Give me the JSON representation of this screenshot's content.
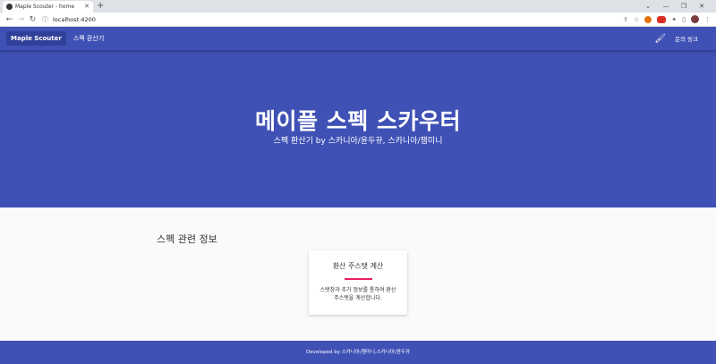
{
  "browser": {
    "tab_title": "Maple Scouter - home",
    "url": "localhost:4200"
  },
  "nav": {
    "brand": "Maple Scouter",
    "link_calculator": "스펙 환산기",
    "contact": "문의 링크"
  },
  "hero": {
    "title": "메이플 스펙 스카우터",
    "subtitle": "스펙 환산기 by 스카니아/윤두뀨, 스카니아/챔미니"
  },
  "section": {
    "title": "스펙 관련 정보",
    "card": {
      "title": "환산 주스탯 계산",
      "description": "스탯창과 추가 정보를 통하여 환산 주스탯을 계산합니다."
    }
  },
  "footer": {
    "text": "Developed by 스카니아/챔미니,스카니아/윤두뀨"
  },
  "colors": {
    "primary": "#3f51b5",
    "accent": "#e91e63"
  }
}
